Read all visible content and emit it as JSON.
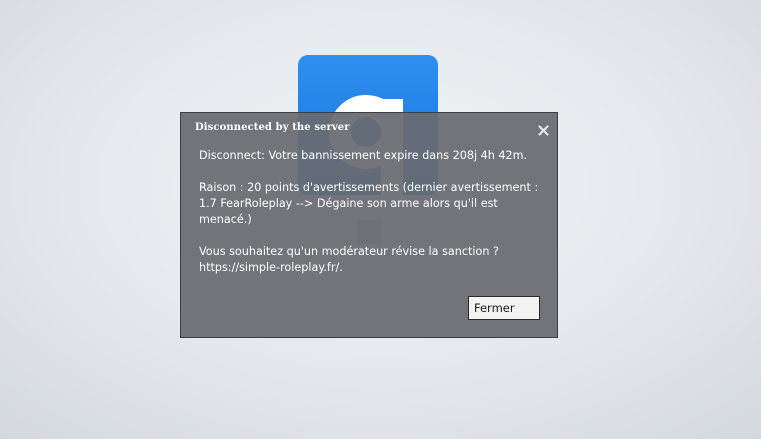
{
  "background": {
    "logo_letter": "g",
    "logo_color": "#1f82e6"
  },
  "dialog": {
    "title": "Disconnected by the server",
    "close_icon": "close-icon",
    "message": "Disconnect: Votre bannissement expire dans 208j 4h 42m.\n\nRaison : 20 points d'avertissements (dernier avertissement : 1.7 FearRoleplay --> Dégaine son arme alors qu'il est menacé.)\n\nVous souhaitez qu'un modérateur révise la sanction ?\nhttps://simple-roleplay.fr/.",
    "button_label": "Fermer",
    "background_color": "#686b70",
    "text_color": "#ffffff"
  }
}
